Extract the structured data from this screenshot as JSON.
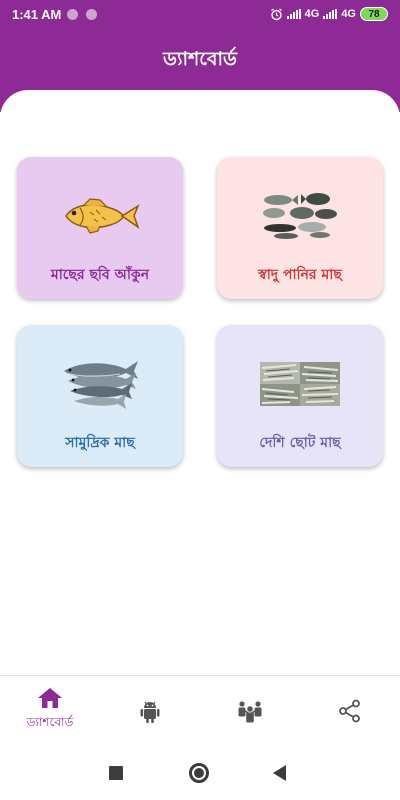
{
  "status_bar": {
    "time": "1:41 AM",
    "network_1": "4G",
    "network_2": "4G",
    "battery": "78",
    "icons": [
      "notification-dot-icon",
      "notification-dot-icon",
      "alarm-icon",
      "signal-icon",
      "signal-icon"
    ]
  },
  "header": {
    "title": "ড্যাশবোর্ড"
  },
  "cards": [
    {
      "label": "মাছের ছবি আঁকুন",
      "icon": "drawn-fish-image",
      "bg": "#e8c9ef",
      "color": "#8b2a98"
    },
    {
      "label": "স্বাদু পানির মাছ",
      "icon": "freshwater-fish-image",
      "bg": "#fde3e3",
      "color": "#d0363a"
    },
    {
      "label": "সামুদ্রিক মাছ",
      "icon": "sea-fish-image",
      "bg": "#dcebf8",
      "color": "#2a6ea6"
    },
    {
      "label": "দেশি ছোট মাছ",
      "icon": "small-fish-image",
      "bg": "#e7e4f7",
      "color": "#6d61a6"
    }
  ],
  "bottom_nav": {
    "items": [
      {
        "icon": "home-icon",
        "label": "ড্যাশবোর্ড",
        "active": true
      },
      {
        "icon": "android-icon"
      },
      {
        "icon": "people-icon"
      },
      {
        "icon": "share-icon"
      }
    ],
    "accent": "#8e2a95"
  },
  "theme": {
    "primary": "#8e2a95"
  }
}
